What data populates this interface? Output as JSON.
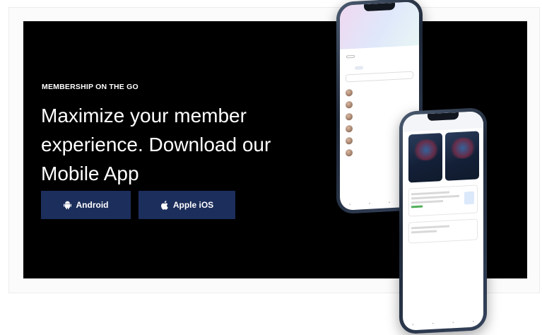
{
  "banner": {
    "eyebrow": "MEMBERSHIP ON THE GO",
    "headline": "Maximize your member experience. Download our Mobile App",
    "buttons": {
      "android_label": "Android",
      "ios_label": "Apple iOS"
    }
  },
  "colors": {
    "banner_bg": "#000000",
    "button_bg": "#1c2e5c",
    "text": "#ffffff"
  },
  "icons": {
    "android": "android-icon",
    "apple": "apple-icon"
  }
}
